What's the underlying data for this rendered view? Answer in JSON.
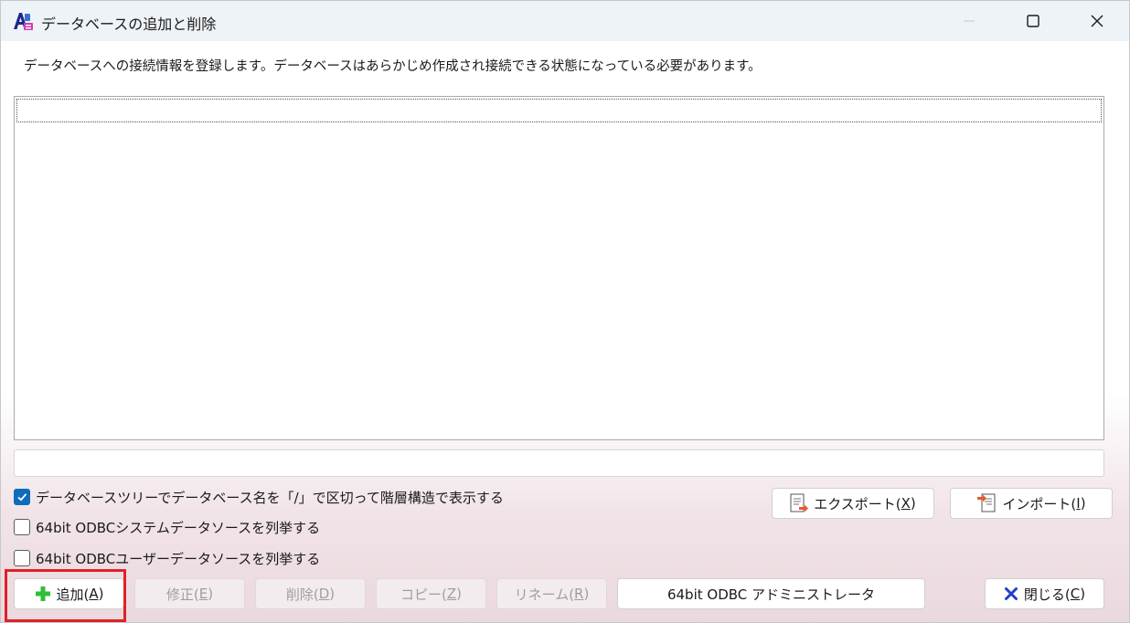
{
  "window": {
    "title": "データベースの追加と削除"
  },
  "description": "データベースへの接続情報を登録します。データベースはあらかじめ作成され接続できる状態になっている必要があります。",
  "options": {
    "tree_slash": {
      "label": "データベースツリーでデータベース名を「/」で区切って階層構造で表示する",
      "checked": true
    },
    "odbc_system": {
      "label": "64bit ODBCシステムデータソースを列挙する",
      "checked": false
    },
    "odbc_user": {
      "label": "64bit ODBCユーザーデータソースを列挙する",
      "checked": false
    }
  },
  "buttons": {
    "export": {
      "label": "エクスポート(",
      "key": "X",
      "tail": ")"
    },
    "import": {
      "label": "インポート(",
      "key": "I",
      "tail": ")"
    },
    "add": {
      "label": "追加(",
      "key": "A",
      "tail": ")"
    },
    "modify": {
      "label": "修正(",
      "key": "E",
      "tail": ")"
    },
    "delete": {
      "label": "削除(",
      "key": "D",
      "tail": ")"
    },
    "copy": {
      "label": "コピー(",
      "key": "Z",
      "tail": ")"
    },
    "rename": {
      "label": "リネーム(",
      "key": "R",
      "tail": ")"
    },
    "odbc_admin": {
      "label": "64bit ODBC アドミニストレータ"
    },
    "close": {
      "label": "閉じる(",
      "key": "C",
      "tail": ")"
    }
  },
  "colors": {
    "accent": "#0f6cbd",
    "add_icon": "#2fbf3a",
    "close_icon": "#2040c8",
    "highlight": "#e0202a"
  }
}
